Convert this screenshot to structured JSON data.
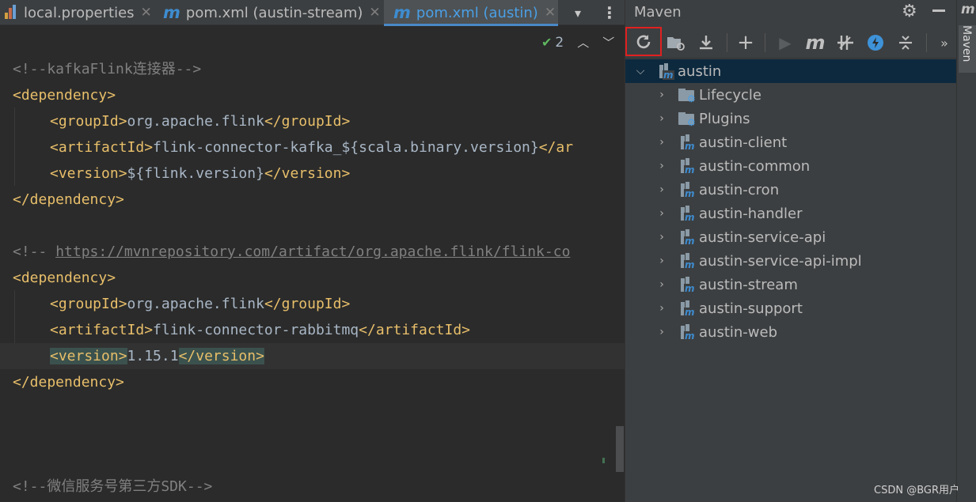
{
  "tabs": [
    {
      "label": "local.properties",
      "active": false
    },
    {
      "label": "pom.xml (austin-stream)",
      "active": false
    },
    {
      "label": "pom.xml (austin)",
      "active": true
    }
  ],
  "editor": {
    "inspection_count": "2",
    "lines": {
      "l1": "<!--kafkaFlink连接器-->",
      "dep_open": "<dependency>",
      "dep_close": "</dependency>",
      "gid_open": "<groupId>",
      "gid_close": "</groupId>",
      "aid_open": "<artifactId>",
      "aid_close_partial": "</ar",
      "aid_close": "</artifactId>",
      "ver_open": "<version>",
      "ver_close": "</version>",
      "group_value": "org.apache.flink",
      "kafka_artifact": "flink-connector-kafka_${scala.binary.version}",
      "flink_version": "${flink.version}",
      "comment2_open": "<!-- ",
      "comment2_url": "https://mvnrepository.com/artifact/org.apache.flink/flink-co",
      "rabbit_artifact": "flink-connector-rabbitmq",
      "rabbit_version": "1.15.1",
      "comment3": "<!--微信服务号第三方SDK-->"
    }
  },
  "maven": {
    "title": "Maven",
    "tree": {
      "root": "austin",
      "folders": [
        "Lifecycle",
        "Plugins"
      ],
      "modules": [
        "austin-client",
        "austin-common",
        "austin-cron",
        "austin-handler",
        "austin-service-api",
        "austin-service-api-impl",
        "austin-stream",
        "austin-support",
        "austin-web"
      ]
    }
  },
  "stripe": {
    "label": "Maven"
  },
  "watermark": "CSDN @BGR用户"
}
